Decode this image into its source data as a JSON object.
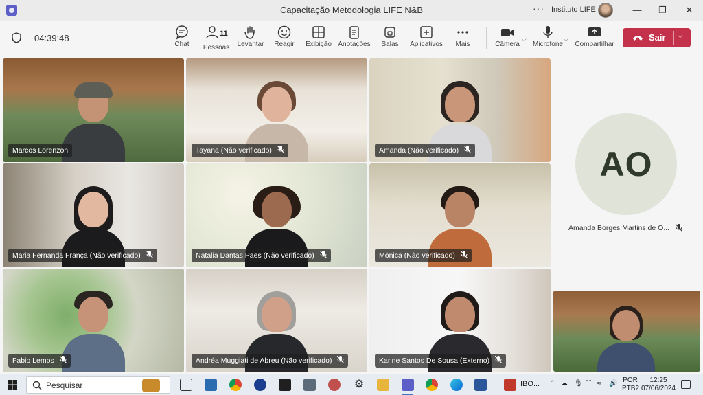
{
  "window": {
    "title": "Capacitação Metodologia LIFE N&B",
    "org": "Instituto LIFE",
    "more_label": "···"
  },
  "toolbar": {
    "timer": "04:39:48",
    "items": [
      {
        "label": "Chat",
        "icon": "chat-icon"
      },
      {
        "label": "Pessoas",
        "icon": "people-icon",
        "count": "11"
      },
      {
        "label": "Levantar",
        "icon": "raise-hand-icon"
      },
      {
        "label": "Reagir",
        "icon": "react-icon"
      },
      {
        "label": "Exibição",
        "icon": "view-icon"
      },
      {
        "label": "Anotações",
        "icon": "notes-icon"
      },
      {
        "label": "Salas",
        "icon": "rooms-icon"
      },
      {
        "label": "Aplicativos",
        "icon": "apps-icon"
      },
      {
        "label": "Mais",
        "icon": "more-icon"
      },
      {
        "label": "Câmera",
        "icon": "camera-icon"
      },
      {
        "label": "Microfone",
        "icon": "microphone-icon"
      },
      {
        "label": "Compartilhar",
        "icon": "share-icon"
      }
    ],
    "leave_label": "Sair",
    "leave_color": "#c4314b"
  },
  "participants": [
    {
      "name": "Marcos Lorenzon",
      "muted": false
    },
    {
      "name": "Tayana (Não verificado)",
      "muted": true
    },
    {
      "name": "Amanda (Não verificado)",
      "muted": true
    },
    {
      "name": "Maria Fernanda França (Não verificado)",
      "muted": true
    },
    {
      "name": "Natalia Dantas Paes (Não verificado)",
      "muted": true
    },
    {
      "name": "Mônica (Não verificado)",
      "muted": true
    },
    {
      "name": "Fabio Lemos",
      "muted": true
    },
    {
      "name": "Andréa Muggiati de Abreu (Não verificado)",
      "muted": true
    },
    {
      "name": "Karine Santos De Sousa (Externo)",
      "muted": true
    }
  ],
  "avatar_participant": {
    "initials": "AO",
    "name": "Amanda Borges Martins de O...",
    "muted": true
  },
  "taskbar": {
    "search_placeholder": "Pesquisar",
    "pinned_label": "IBO...",
    "language": "POR",
    "layout": "PTB2",
    "time": "12:25",
    "date": "07/06/2024"
  }
}
